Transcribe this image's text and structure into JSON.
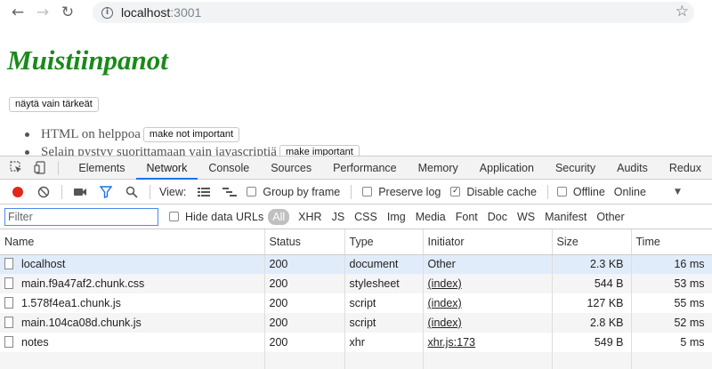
{
  "browser": {
    "back_icon": "←",
    "forward_icon": "→",
    "reload_icon": "↻",
    "info_icon": "i",
    "url_host": "localhost",
    "url_port": ":3001",
    "star_icon": "☆"
  },
  "page": {
    "title": "Muistiinpanot",
    "toggle_button": "näytä vain tärkeät",
    "notes": [
      {
        "content": "HTML on helppoa",
        "button": "make not important"
      },
      {
        "content": "Selain pystyy suorittamaan vain javascriptiä",
        "button": "make important"
      }
    ]
  },
  "devtools": {
    "tabs": [
      "Elements",
      "Network",
      "Console",
      "Sources",
      "Performance",
      "Memory",
      "Application",
      "Security",
      "Audits",
      "Redux"
    ],
    "active_tab": "Network",
    "toolbar": {
      "view_label": "View:",
      "group_by_frame": "Group by frame",
      "preserve_log": "Preserve log",
      "disable_cache": "Disable cache",
      "disable_cache_checked": true,
      "offline": "Offline",
      "throttling": "Online",
      "dropdown_icon": "▼"
    },
    "filter": {
      "placeholder": "Filter",
      "hide_data_urls": "Hide data URLs",
      "types": [
        "All",
        "XHR",
        "JS",
        "CSS",
        "Img",
        "Media",
        "Font",
        "Doc",
        "WS",
        "Manifest",
        "Other"
      ],
      "active_type": "All"
    },
    "columns": [
      "Name",
      "Status",
      "Type",
      "Initiator",
      "Size",
      "Time"
    ],
    "rows": [
      {
        "name": "localhost",
        "status": "200",
        "type": "document",
        "initiator": "Other",
        "size": "2.3 KB",
        "time": "16 ms"
      },
      {
        "name": "main.f9a47af2.chunk.css",
        "status": "200",
        "type": "stylesheet",
        "initiator": "(index)",
        "size": "544 B",
        "time": "53 ms"
      },
      {
        "name": "1.578f4ea1.chunk.js",
        "status": "200",
        "type": "script",
        "initiator": "(index)",
        "size": "127 KB",
        "time": "55 ms"
      },
      {
        "name": "main.104ca08d.chunk.js",
        "status": "200",
        "type": "script",
        "initiator": "(index)",
        "size": "2.8 KB",
        "time": "52 ms"
      },
      {
        "name": "notes",
        "status": "200",
        "type": "xhr",
        "initiator": "xhr.js:173",
        "size": "549 B",
        "time": "5 ms"
      }
    ]
  }
}
